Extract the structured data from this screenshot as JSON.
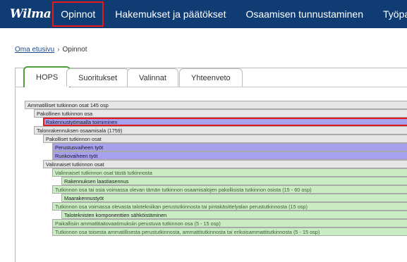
{
  "app": {
    "logo": "Wilma"
  },
  "nav": {
    "items": [
      {
        "label": "Opinnot",
        "active": true
      },
      {
        "label": "Hakemukset ja päätökset",
        "active": false
      },
      {
        "label": "Osaamisen tunnustaminen",
        "active": false
      },
      {
        "label": "Työpaik",
        "active": false
      }
    ]
  },
  "breadcrumb": {
    "home": "Oma etusivu",
    "separator": "›",
    "current": "Opinnot"
  },
  "tabs": [
    {
      "label": "HOPS",
      "active": true
    },
    {
      "label": "Suoritukset",
      "active": false
    },
    {
      "label": "Valinnat",
      "active": false
    },
    {
      "label": "Yhteenveto",
      "active": false
    }
  ],
  "tree": [
    {
      "text": "Ammatilliset tutkinnon osat 145 osp",
      "level": 0,
      "style": "grey"
    },
    {
      "text": "Pakollinen tutkinnon osa",
      "level": 1,
      "style": "grey"
    },
    {
      "text": "Rakennustyömaalla toimiminen",
      "level": 2,
      "style": "purple",
      "highlighted": true
    },
    {
      "text": "Talonrakennuksen osaamisala (1759)",
      "level": 1,
      "style": "grey"
    },
    {
      "text": "Pakolliset tutkinnon osat",
      "level": 2,
      "style": "grey"
    },
    {
      "text": "Perustusvaiheen työt",
      "level": 3,
      "style": "purple"
    },
    {
      "text": "Runkovaiheen työt",
      "level": 3,
      "style": "purple"
    },
    {
      "text": "Valinnaiset tutkinnon osat",
      "level": 2,
      "style": "grey"
    },
    {
      "text": "Valinnaiset tutkinnon osat tästä tutkinnosta",
      "level": 3,
      "style": "green"
    },
    {
      "text": "Rakennuksen laastiasennus",
      "level": 4,
      "style": "green-strong"
    },
    {
      "text": "Tutkinnon osa tai osia voimassa olevan tämän tutkinnon osaamisalojen pakollisista tutkinnon osista (15 - 60 osp)",
      "level": 3,
      "style": "green"
    },
    {
      "text": "Maarakennustyöt",
      "level": 4,
      "style": "green-strong"
    },
    {
      "text": "Tutkinnon osa voimassa olevasta talotekniikan perustutkinnosta tai pintakäsittelyalan perustutkinnosta (15 osp)",
      "level": 3,
      "style": "green"
    },
    {
      "text": "Taloteknisten komponenttien sähköistäminen",
      "level": 4,
      "style": "green-strong"
    },
    {
      "text": "Paikallisiin ammattitaitovaatimuksiin perustuva tutkinnon osa (5 - 15 osp)",
      "level": 3,
      "style": "green"
    },
    {
      "text": "Tutkinnon osa toisesta ammatillisesta perustutkinnosta, ammattitutkinnosta tai erikoisammattitutkinnosta (5 - 15 osp)",
      "level": 3,
      "style": "green"
    }
  ]
}
